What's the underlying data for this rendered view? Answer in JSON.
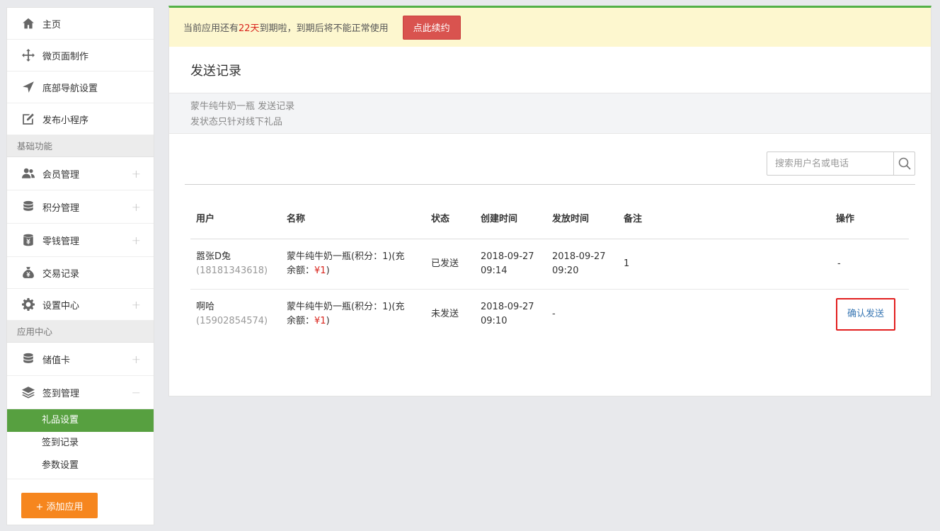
{
  "sidebar": {
    "top_items": [
      {
        "label": "主页",
        "icon": "home-icon"
      },
      {
        "label": "微页面制作",
        "icon": "move-icon"
      },
      {
        "label": "底部导航设置",
        "icon": "navigation-arrow-icon"
      },
      {
        "label": "发布小程序",
        "icon": "edit-icon"
      }
    ],
    "section_basic": "基础功能",
    "basic_items": [
      {
        "label": "会员管理",
        "icon": "users-icon",
        "sign": "+"
      },
      {
        "label": "积分管理",
        "icon": "database-icon",
        "sign": "+"
      },
      {
        "label": "零钱管理",
        "icon": "yen-cylinder-icon",
        "sign": "+"
      },
      {
        "label": "交易记录",
        "icon": "money-bag-icon",
        "sign": ""
      },
      {
        "label": "设置中心",
        "icon": "gear-icon",
        "sign": "+"
      }
    ],
    "section_apps": "应用中心",
    "app_items": [
      {
        "label": "储值卡",
        "icon": "database-icon",
        "sign": "+"
      },
      {
        "label": "签到管理",
        "icon": "layers-icon",
        "sign": "−"
      }
    ],
    "sub_items": [
      {
        "label": "礼品设置",
        "active": true
      },
      {
        "label": "签到记录",
        "active": false
      },
      {
        "label": "参数设置",
        "active": false
      }
    ],
    "add_app_label": "+ 添加应用"
  },
  "notice": {
    "prefix": "当前应用还有",
    "days": "22天",
    "suffix": "到期啦，到期后将不能正常使用",
    "renew_label": "点此续约"
  },
  "page": {
    "title": "发送记录",
    "info_line1": "蒙牛纯牛奶一瓶 发送记录",
    "info_line2": "发状态只针对线下礼品"
  },
  "search": {
    "placeholder": "搜索用户名或电话"
  },
  "table": {
    "headers": {
      "user": "用户",
      "name": "名称",
      "status": "状态",
      "created": "创建时间",
      "sent": "发放时间",
      "remark": "备注",
      "op": "操作"
    },
    "rows": [
      {
        "user": "嚣张D兔",
        "phone": "(18181343618)",
        "name_line1": "蒙牛纯牛奶一瓶(积分：1)(充",
        "name_line2_prefix": "余额：",
        "price": "¥1",
        "name_line2_suffix": ")",
        "status": "已发送",
        "created_date": "2018-09-27",
        "created_time": "09:14",
        "sent_date": "2018-09-27",
        "sent_time": "09:20",
        "remark": "1",
        "op": "-"
      },
      {
        "user": "啊哈",
        "phone": "(15902854574)",
        "name_line1": "蒙牛纯牛奶一瓶(积分：1)(充",
        "name_line2_prefix": "余额：",
        "price": "¥1",
        "name_line2_suffix": ")",
        "status": "未发送",
        "created_date": "2018-09-27",
        "created_time": "09:10",
        "sent_date": "-",
        "sent_time": "",
        "remark": "",
        "op": "确认发送"
      }
    ]
  },
  "colors": {
    "accent_green": "#57a040",
    "renew_red": "#d9534f",
    "add_orange": "#f6861e",
    "highlight_red": "#e21f1f",
    "link_blue": "#3a78b4"
  }
}
